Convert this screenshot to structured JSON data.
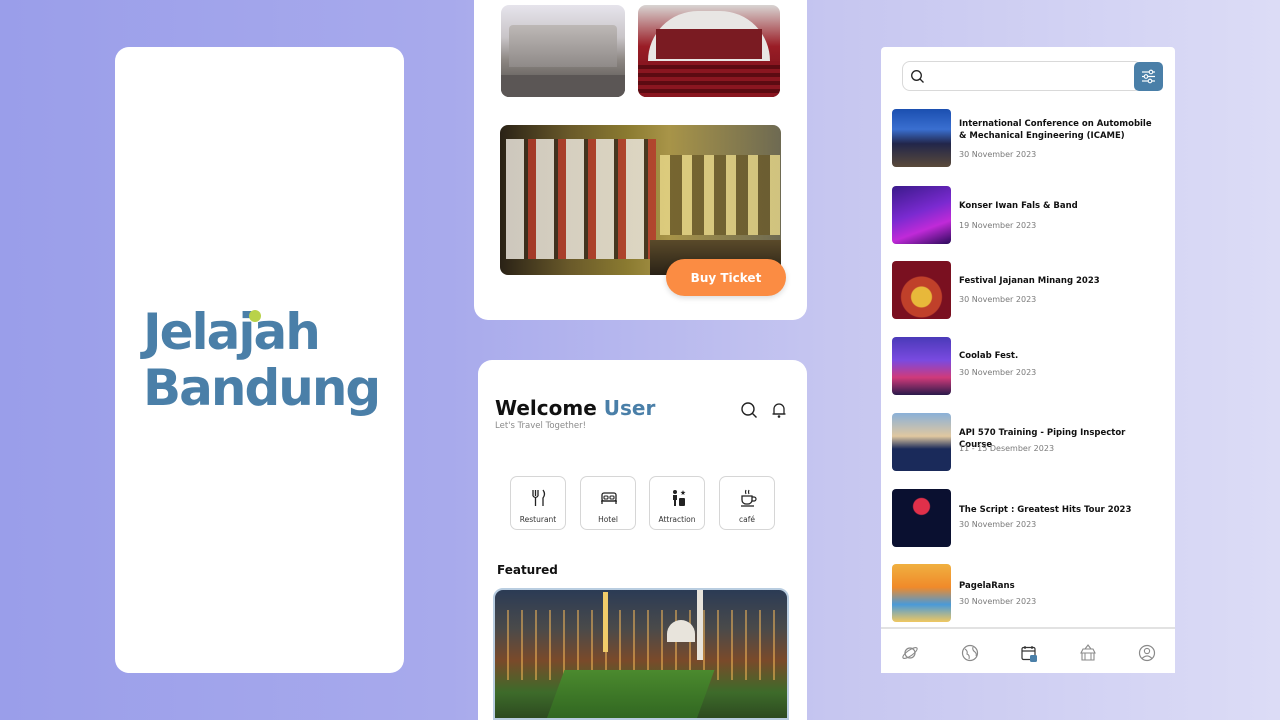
{
  "splash": {
    "logo_line1": "Jelajah",
    "logo_line2": "Bandung",
    "logo_color": "#4a7fa8",
    "logo_dot_color": "#b9d24a"
  },
  "detail": {
    "buy_ticket_label": "Buy Ticket",
    "button_color": "#fb8c43"
  },
  "home": {
    "welcome_prefix": "Welcome",
    "welcome_user": "User",
    "subtitle": "Let's Travel Together!",
    "categories": [
      {
        "label": "Resturant",
        "icon": "cutlery-icon"
      },
      {
        "label": "Hotel",
        "icon": "bed-icon"
      },
      {
        "label": "Attraction",
        "icon": "attraction-icon"
      },
      {
        "label": "café",
        "icon": "coffee-cup-icon"
      }
    ],
    "featured_label": "Featured"
  },
  "events": {
    "search_placeholder": "",
    "items": [
      {
        "title": "International Conference on Automobile & Mechanical Engineering (ICAME)",
        "date": "30 November 2023"
      },
      {
        "title": "Konser Iwan Fals & Band",
        "date": "19 November 2023"
      },
      {
        "title": "Festival Jajanan Minang 2023",
        "date": "30 November 2023"
      },
      {
        "title": "Coolab Fest.",
        "date": "30 November 2023"
      },
      {
        "title": "API 570 Training - Piping Inspector Course",
        "date": "11 - 15 Desember 2023"
      },
      {
        "title": "The Script : Greatest Hits Tour 2023",
        "date": "30 November 2023"
      },
      {
        "title": "PagelaRans",
        "date": "30 November 2023"
      }
    ],
    "nav": [
      "planet-icon",
      "globe-icon",
      "calendar-icon",
      "temple-icon",
      "profile-icon"
    ],
    "accent_color": "#4a7fa8"
  }
}
